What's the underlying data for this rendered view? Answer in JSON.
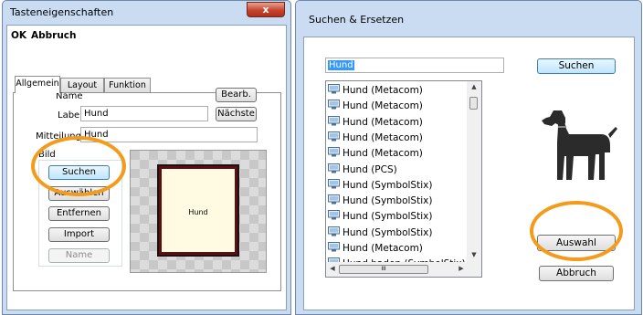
{
  "dialog1": {
    "title": "Tasteneigenschaften",
    "close_label": "x",
    "menu": {
      "ok": "OK",
      "cancel": "Abbruch"
    },
    "tabs": [
      "Allgemein",
      "Layout",
      "Funktion"
    ],
    "name_label": "Name",
    "label_label": "Label",
    "label_value": "Hund",
    "message_label": "Mitteilung",
    "message_value": "Hund",
    "edit_button": "Bearb.",
    "next_button": "Nächste",
    "image_group": "Bild",
    "buttons": [
      "Suchen",
      "Auswählen",
      "Entfernen",
      "Import",
      "Name"
    ],
    "card_text": "Hund"
  },
  "dialog2": {
    "title": "Suchen & Ersetzen",
    "search_value": "Hund",
    "search_button": "Suchen",
    "results": [
      "Hund (Metacom)",
      "Hund (Metacom)",
      "Hund (Metacom)",
      "Hund (Metacom)",
      "Hund (Metacom)",
      "Hund (PCS)",
      "Hund (SymbolStix)",
      "Hund (SymbolStix)",
      "Hund (SymbolStix)",
      "Hund (SymbolStix)",
      "Hund  (Metacom)",
      "Hund baden (SymbolStix)"
    ],
    "hscroll_thumb": "III",
    "select_button": "Auswahl",
    "cancel_button": "Abbruch"
  },
  "colors": {
    "window_frame": "#c9dcf1",
    "highlight_ring": "#f39b1a",
    "selection": "#3399ff",
    "card_fill": "#fffbe2",
    "card_border": "#5a1010"
  },
  "icons": {
    "close": "close-icon",
    "result": "computer-symbol-icon",
    "preview": "dog-icon"
  }
}
